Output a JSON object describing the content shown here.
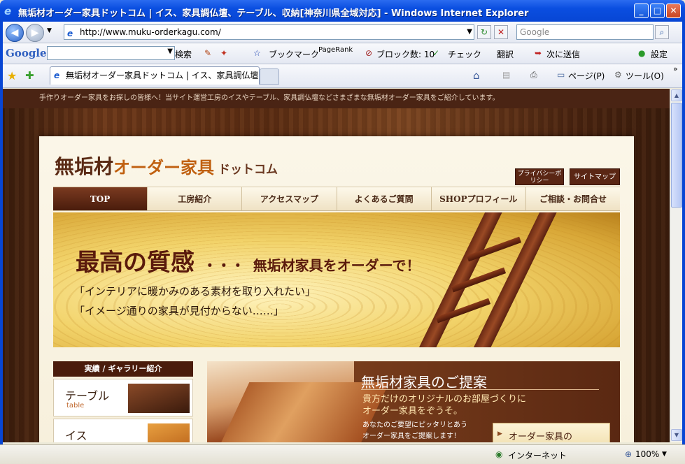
{
  "window": {
    "title": "無垢材オーダー家具ドットコム | イス、家具調仏壇、テーブル、収納[神奈川県全域対応] - Windows Internet Explorer",
    "minimize": "_",
    "maximize": "□",
    "close": "✕"
  },
  "address_bar": {
    "url": "http://www.muku-orderkagu.com/",
    "search_placeholder": "Google"
  },
  "google_toolbar": {
    "logo": "Google",
    "search": "検索",
    "bookmarks": "ブックマーク",
    "pagerank": "PageRank",
    "blocked": "ブロック数: 10",
    "check": "チェック",
    "translate": "翻訳",
    "send_to": "次に送信",
    "settings": "設定"
  },
  "tab": {
    "label": "無垢材オーダー家具ドットコム | イス、家具調仏壇、テ..."
  },
  "command_bar": {
    "page": "ページ(P)",
    "tools": "ツール(O)"
  },
  "site": {
    "intro": "手作りオーダー家具をお探しの皆様へ！当サイト運営工房のイスやテーブル、家具調仏壇などさまざまな無垢材オーダー家具をご紹介しています。",
    "logo_part1": "無垢材",
    "logo_part2": "オーダー家具",
    "logo_part3": "ドットコム",
    "privacy_button": "プライバシーポリシー",
    "sitemap_button": "サイトマップ",
    "nav": [
      "TOP",
      "工房紹介",
      "アクセスマップ",
      "よくあるご質問",
      "SHOPプロフィール",
      "ご相談・お問合せ"
    ],
    "hero": {
      "headline": "最高の質感",
      "dots": "・・・",
      "sub": "無垢材家具をオーダーで！",
      "line1": "「インテリアに暖かみのある素材を取り入れたい」",
      "line2": "「イメージ通りの家具が見付からない……」"
    },
    "sidebar": {
      "heading": "実績 / ギャラリー紹介",
      "items": [
        {
          "title": "テーブル",
          "sub": "table"
        },
        {
          "title": "イス",
          "sub": ""
        }
      ]
    },
    "promo": {
      "heading": "無垢材家具のご提案",
      "sub1": "貴方だけのオリジナルのお部屋づくりに",
      "sub2": "オーダー家具をぞうそ。",
      "body1": "あなたのご要望にピッタリとあう",
      "body2": "オーダー家具をご提案します！",
      "order_button": "オーダー家具の"
    }
  },
  "status_bar": {
    "zone": "インターネット",
    "zoom": "100%"
  }
}
